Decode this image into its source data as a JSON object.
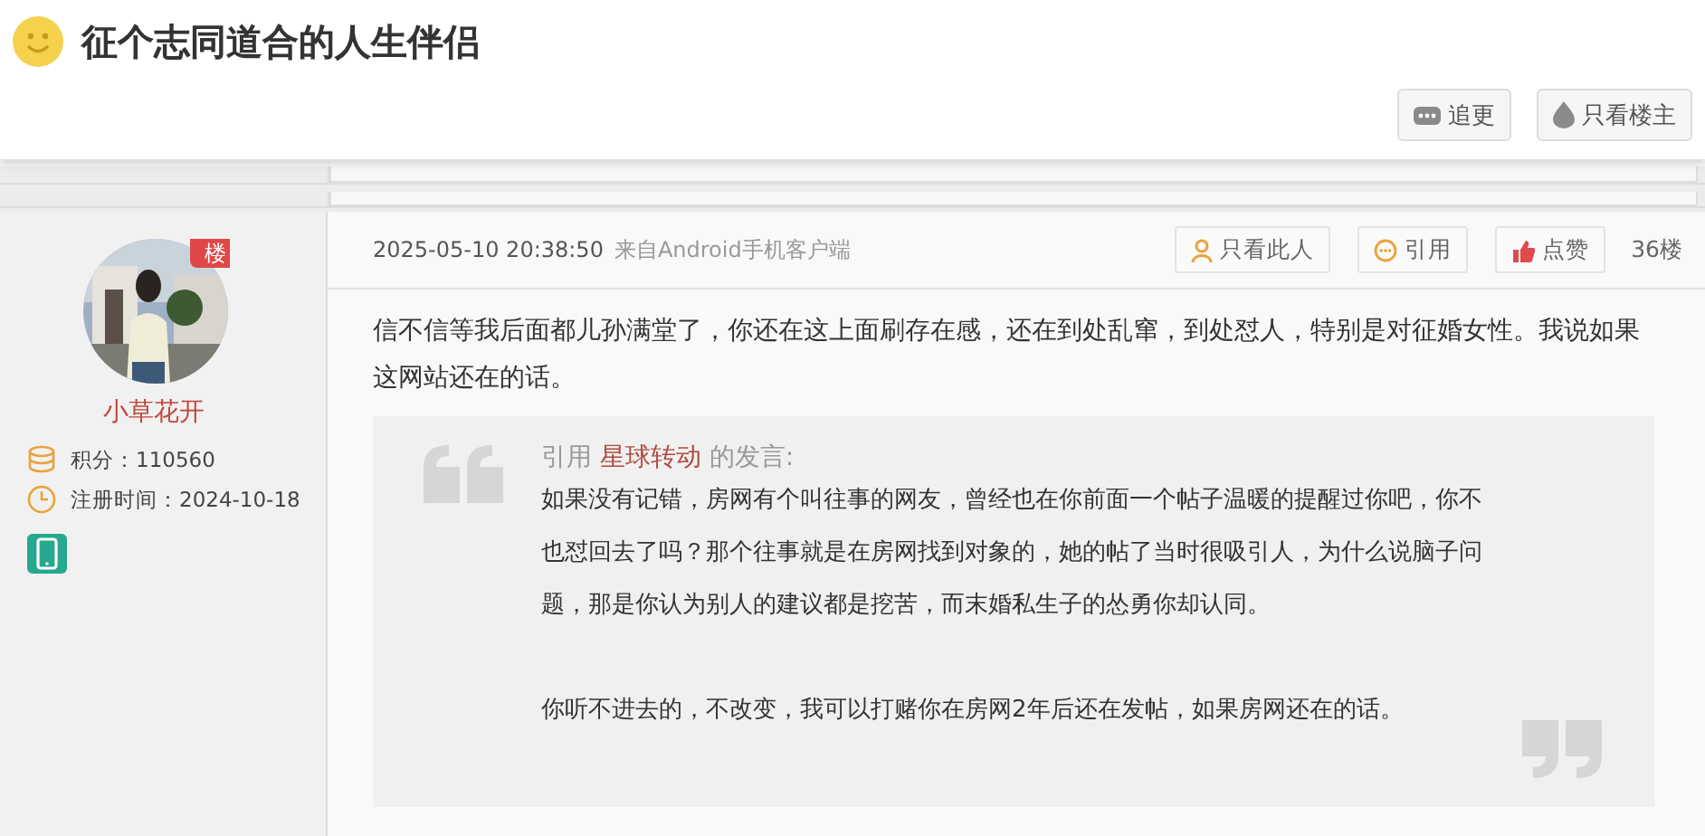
{
  "thread": {
    "title": "征个志同道合的人生伴侣",
    "buttons": [
      {
        "kind": "follow",
        "label": "追更"
      },
      {
        "kind": "owner",
        "label": "只看楼主"
      }
    ]
  },
  "post": {
    "author": {
      "name": "小草花开",
      "badge": "楼",
      "stats": [
        {
          "kind": "points",
          "text": "积分：110560"
        },
        {
          "kind": "joined",
          "text": "注册时间：2024-10-18"
        }
      ],
      "device": {
        "kind": "mobile"
      }
    },
    "timestamp": "2025-05-10 20:38:50",
    "source": "来自Android手机客户端",
    "actions": [
      {
        "kind": "person",
        "label": "只看此人"
      },
      {
        "kind": "quote",
        "label": "引用"
      },
      {
        "kind": "like",
        "label": "点赞"
      }
    ],
    "floor": "36楼",
    "text": "信不信等我后面都儿孙满堂了，你还在这上面刷存在感，还在到处乱窜，到处怼人，特别是对征婚女性。我说如果这网站还在的话。",
    "quote": {
      "prefix": "引用",
      "author": "星球转动",
      "suffix": "的发言:",
      "paragraphs": [
        "如果没有记错，房网有个叫往事的网友，曾经也在你前面一个帖子温暖的提醒过你吧，你不也怼回去了吗？那个往事就是在房网找到对象的，她的帖了当时很吸引人，为什么说脑子问题，那是你认为别人的建议都是挖苦，而末婚私生子的怂勇你却认同。",
        "你听不进去的，不改变，我可以打赌你在房网2年后还在发帖，如果房网还在的话。"
      ]
    }
  }
}
